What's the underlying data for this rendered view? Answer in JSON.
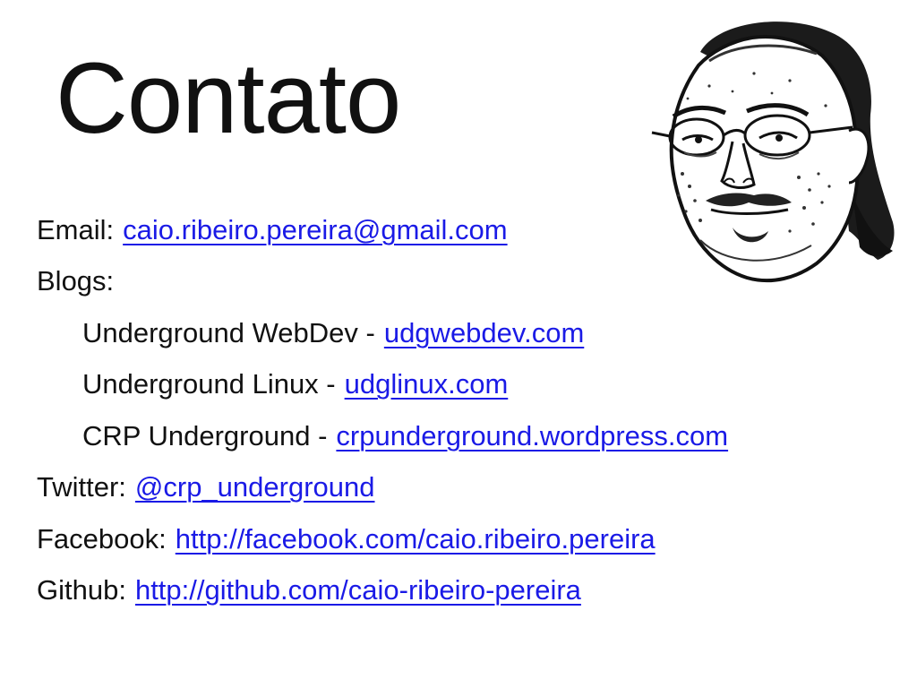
{
  "slide": {
    "title": "Contato"
  },
  "contact": {
    "email_label": "Email:",
    "email_link": "caio.ribeiro.pereira@gmail.com",
    "blogs_label": "Blogs:",
    "blogs": [
      {
        "name": "Underground WebDev -",
        "link": "udgwebdev.com"
      },
      {
        "name": "Underground Linux -",
        "link": "udglinux.com"
      },
      {
        "name": "CRP Underground -",
        "link": "crpunderground.wordpress.com"
      }
    ],
    "twitter_label": "Twitter:",
    "twitter_link": "@crp_underground",
    "facebook_label": "Facebook:",
    "facebook_link": "http://facebook.com/caio.ribeiro.pereira",
    "github_label": "Github:",
    "github_link": "http://github.com/caio-ribeiro-pereira"
  },
  "colors": {
    "link": "#1a1ae6",
    "text": "#111111",
    "background": "#ffffff"
  },
  "image": {
    "icon": "meme-face-with-glasses-illustration"
  }
}
